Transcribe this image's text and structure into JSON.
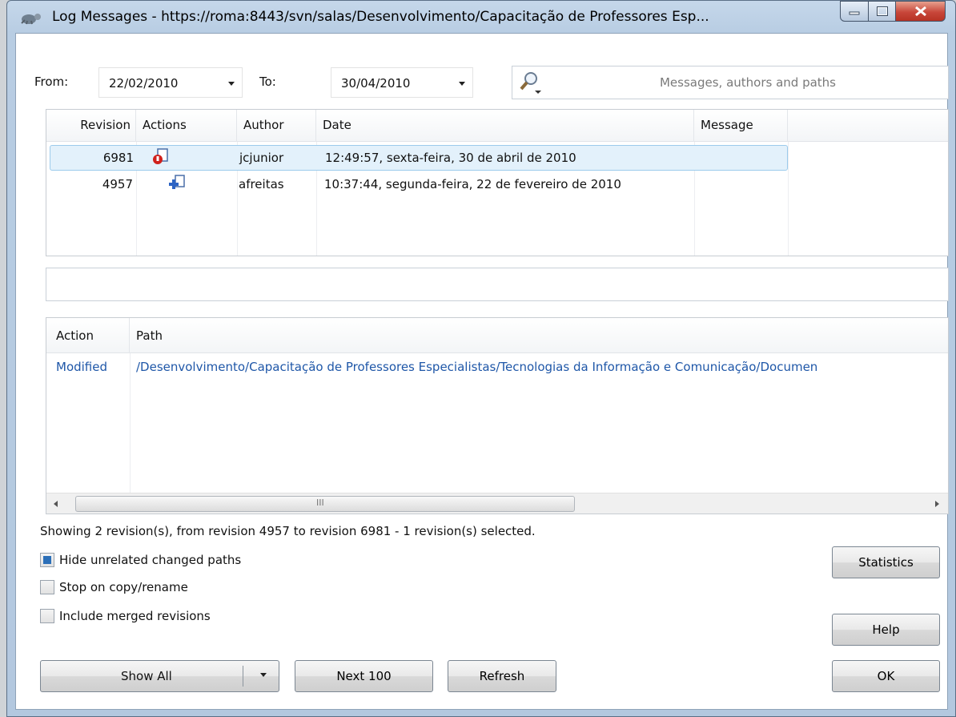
{
  "window": {
    "title": "Log Messages - https://roma:8443/svn/salas/Desenvolvimento/Capacitação de Professores Esp..."
  },
  "filter": {
    "from_label": "From:",
    "from_value": "22/02/2010",
    "to_label": "To:",
    "to_value": "30/04/2010",
    "search_placeholder": "Messages, authors and paths"
  },
  "revisions": {
    "columns": [
      "Revision",
      "Actions",
      "Author",
      "Date",
      "Message"
    ],
    "rows": [
      {
        "revision": "6981",
        "action_icon": "modified-deleted-icon",
        "author": "jcjunior",
        "date": "12:49:57, sexta-feira, 30 de abril de 2010",
        "message": "",
        "selected": true
      },
      {
        "revision": "4957",
        "action_icon": "added-icon",
        "author": "afreitas",
        "date": "10:37:44, segunda-feira, 22 de fevereiro de 2010",
        "message": "",
        "selected": false
      }
    ]
  },
  "message_text": "",
  "paths": {
    "columns": [
      "Action",
      "Path"
    ],
    "rows": [
      {
        "action": "Modified",
        "path": "/Desenvolvimento/Capacitação de Professores Especialistas/Tecnologias da Informação e Comunicação/Documen"
      }
    ],
    "scroll_grip": "III"
  },
  "status_text": "Showing 2 revision(s), from revision 4957 to revision 6981 - 1 revision(s) selected.",
  "options": {
    "hide_unrelated": {
      "label": "Hide unrelated changed paths",
      "checked": true
    },
    "stop_on_copy": {
      "label": "Stop on copy/rename",
      "checked": false
    },
    "include_merged": {
      "label": "Include merged revisions",
      "checked": false
    }
  },
  "buttons": {
    "show_all": "Show All",
    "next_100": "Next 100",
    "refresh": "Refresh",
    "statistics": "Statistics",
    "help": "Help",
    "ok": "OK"
  },
  "colors": {
    "selection": "#e3f1fb",
    "path_link": "#1f57a8",
    "close_button": "#c8473a"
  }
}
